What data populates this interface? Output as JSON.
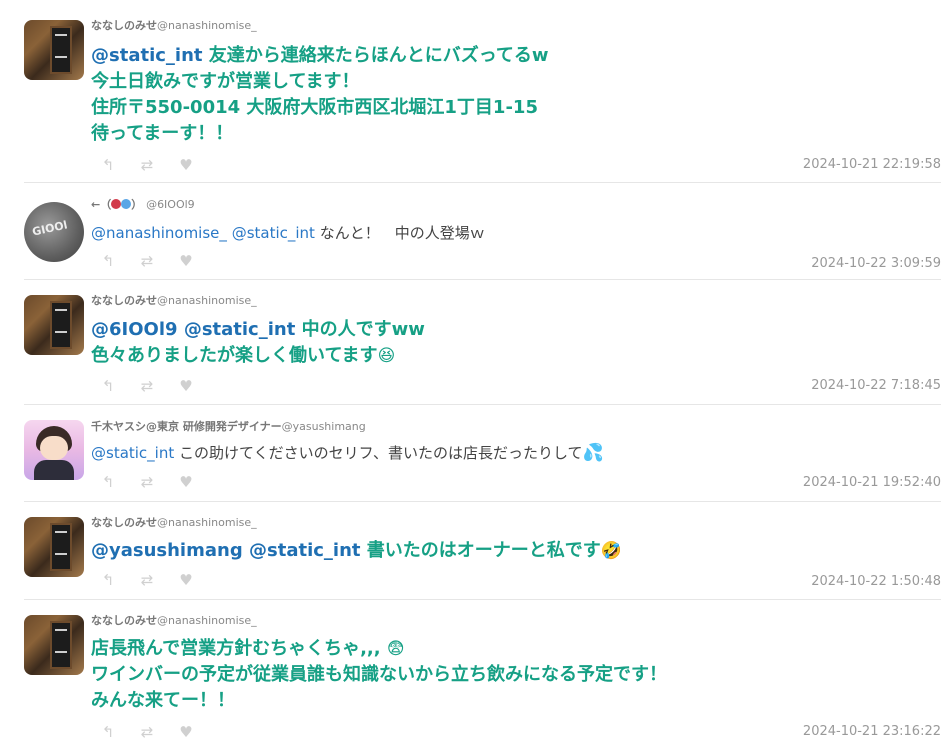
{
  "tweets": [
    {
      "user": {
        "name": "ななしのみせ",
        "handle": "@nanashinomise_",
        "avatar": "shop-sign-avatar"
      },
      "lines": [
        [
          {
            "mention": "@static_int"
          },
          {
            "text": " 友達から連絡来たらほんとにバズってるw"
          }
        ],
        [
          {
            "text": "今土日飲みですが営業してます！"
          }
        ],
        [
          {
            "text": "住所〒550-0014 大阪府大阪市西区北堀江1丁目1-15"
          }
        ],
        [
          {
            "text": "待ってまーす！！"
          }
        ]
      ],
      "timestamp": "2024-10-21 22:19:58"
    },
    {
      "user": {
        "name_prefix": "←（",
        "name_suffix": "）",
        "handle": "@6IOOl9",
        "avatar": "circle-logo-avatar"
      },
      "lines": [
        [
          {
            "mention": "@nanashinomise_"
          },
          {
            "text": " "
          },
          {
            "mention": "@static_int"
          },
          {
            "text": " なんと！　中の人登場ｗ"
          }
        ]
      ],
      "timestamp": "2024-10-22 3:09:59"
    },
    {
      "user": {
        "name": "ななしのみせ",
        "handle": "@nanashinomise_",
        "avatar": "shop-sign-avatar"
      },
      "lines": [
        [
          {
            "mention": "@6IOOl9"
          },
          {
            "text": " "
          },
          {
            "mention": "@static_int"
          },
          {
            "text": " 中の人ですww"
          }
        ],
        [
          {
            "text": "色々ありましたが楽しく働いてます"
          },
          {
            "emoji": "😆"
          }
        ]
      ],
      "timestamp": "2024-10-22 7:18:45"
    },
    {
      "user": {
        "name": "千木ヤスシ@東京 研修開発デザイナー",
        "handle": "@yasushimang",
        "avatar": "illustrated-person-avatar"
      },
      "lines": [
        [
          {
            "mention": "@static_int"
          },
          {
            "text": " この助けてくださいのセリフ、書いたのは店長だったりして"
          },
          {
            "emoji": "💦"
          }
        ]
      ],
      "timestamp": "2024-10-21 19:52:40"
    },
    {
      "user": {
        "name": "ななしのみせ",
        "handle": "@nanashinomise_",
        "avatar": "shop-sign-avatar"
      },
      "lines": [
        [
          {
            "mention": "@yasushimang"
          },
          {
            "text": " "
          },
          {
            "mention": "@static_int"
          },
          {
            "text": " 書いたのはオーナーと私です"
          },
          {
            "emoji": "🤣"
          }
        ]
      ],
      "timestamp": "2024-10-22 1:50:48"
    },
    {
      "user": {
        "name": "ななしのみせ",
        "handle": "@nanashinomise_",
        "avatar": "shop-sign-avatar"
      },
      "lines": [
        [
          {
            "text": "店長飛んで営業方針むちゃくちゃ,,, "
          },
          {
            "emoji": "😨"
          }
        ],
        [
          {
            "text": "ワインバーの予定が従業員誰も知識ないから立ち飲みになる予定です！"
          }
        ],
        [
          {
            "text": "みんな来てー！！"
          }
        ]
      ],
      "timestamp": "2024-10-21 23:16:22"
    }
  ],
  "icons": {
    "reply": "↰",
    "retweet": "⇄",
    "like": "♥"
  },
  "colors": {
    "mention": "#1f6fb2",
    "big_text": "#16a085",
    "meta": "#999999"
  }
}
